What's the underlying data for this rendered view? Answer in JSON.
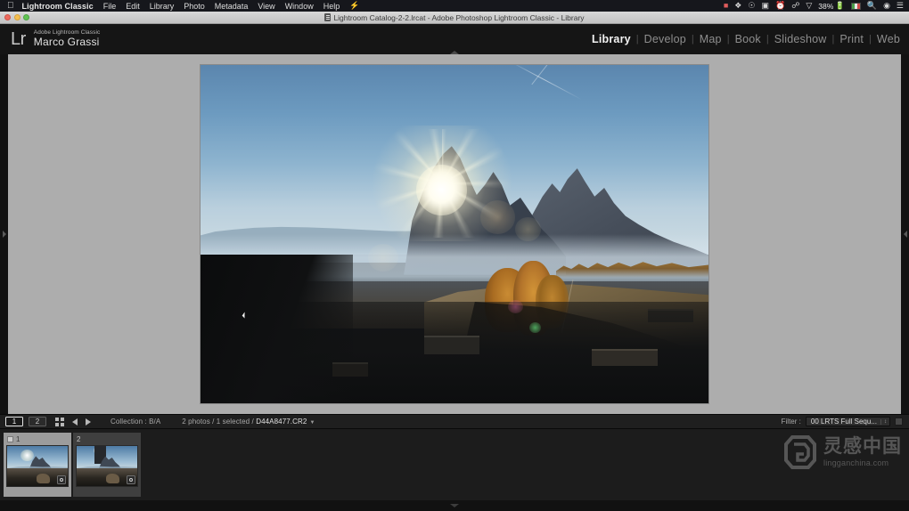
{
  "menubar": {
    "apple_icon": "apple-icon",
    "app_name": "Lightroom Classic",
    "items": [
      "File",
      "Edit",
      "Library",
      "Photo",
      "Metadata",
      "View",
      "Window",
      "Help"
    ],
    "bolt_icon": "bolt-icon",
    "status": {
      "battery_percent": "38%",
      "icons": [
        "recording-icon",
        "dropbox-icon",
        "cloud-icon",
        "display-icon",
        "timemachine-icon",
        "bluetooth-icon",
        "wifi-icon",
        "battery-icon",
        "flag-italy-icon",
        "search-icon",
        "account-icon",
        "notifications-icon"
      ]
    }
  },
  "window": {
    "title": "Lightroom Catalog-2-2.lrcat - Adobe Photoshop Lightroom Classic - Library",
    "doc_icon": "document-icon",
    "traffic_lights": [
      "close",
      "minimize",
      "zoom"
    ]
  },
  "identity": {
    "logo": "Lr",
    "line1": "Adobe Lightroom Classic",
    "line2": "Marco Grassi"
  },
  "modules": [
    {
      "label": "Library",
      "active": true
    },
    {
      "label": "Develop",
      "active": false
    },
    {
      "label": "Map",
      "active": false
    },
    {
      "label": "Book",
      "active": false
    },
    {
      "label": "Slideshow",
      "active": false
    },
    {
      "label": "Print",
      "active": false
    },
    {
      "label": "Web",
      "active": false
    }
  ],
  "module_separator": "|",
  "panels": {
    "left_arrow_icon": "chevron-right-icon",
    "right_arrow_icon": "chevron-left-icon",
    "top_arrow_icon": "chevron-up-icon",
    "bottom_arrow_icon": "chevron-down-icon"
  },
  "photo": {
    "description": "Sunburst over Dolomites peaks at Alpe di Siusi with autumn larch trees and alpine huts",
    "cursor_x": "271",
    "cursor_y": "352"
  },
  "toolbar": {
    "page_buttons": [
      {
        "label": "1",
        "selected": true
      },
      {
        "label": "2",
        "selected": false
      }
    ],
    "grid_icon": "grid-view-icon",
    "prev_icon": "arrow-left-icon",
    "next_icon": "arrow-right-icon",
    "source": "Collection : B/A",
    "count_prefix": "2 photos / 1 selected / ",
    "current_file": "D44A8477.CR2",
    "carat_icon": "chevron-down-icon",
    "filter_label": "Filter :",
    "filter_value": "00 LRTS Full Sequ...",
    "filter_arrow_icon": "select-arrows-icon",
    "filter_lock_icon": "filter-toggle-icon"
  },
  "filmstrip": {
    "thumbnails": [
      {
        "number": "1",
        "selected": true,
        "badge_icon": "develop-badge-icon",
        "flag_icon": "pick-flag-icon"
      },
      {
        "number": "2",
        "selected": false,
        "badge_icon": "develop-badge-icon"
      }
    ]
  },
  "watermark": {
    "logo_icon": "lingganchina-logo-icon",
    "cn_text": "灵感中国",
    "en_text": "lingganchina",
    "en_suffix": ".com"
  },
  "colors": {
    "panel_bg": "#151515",
    "canvas_bg": "#adadad",
    "filmstrip_bg": "#1c1c1c",
    "accent_text": "#f2f2f2",
    "battery_green": "#61c454"
  }
}
